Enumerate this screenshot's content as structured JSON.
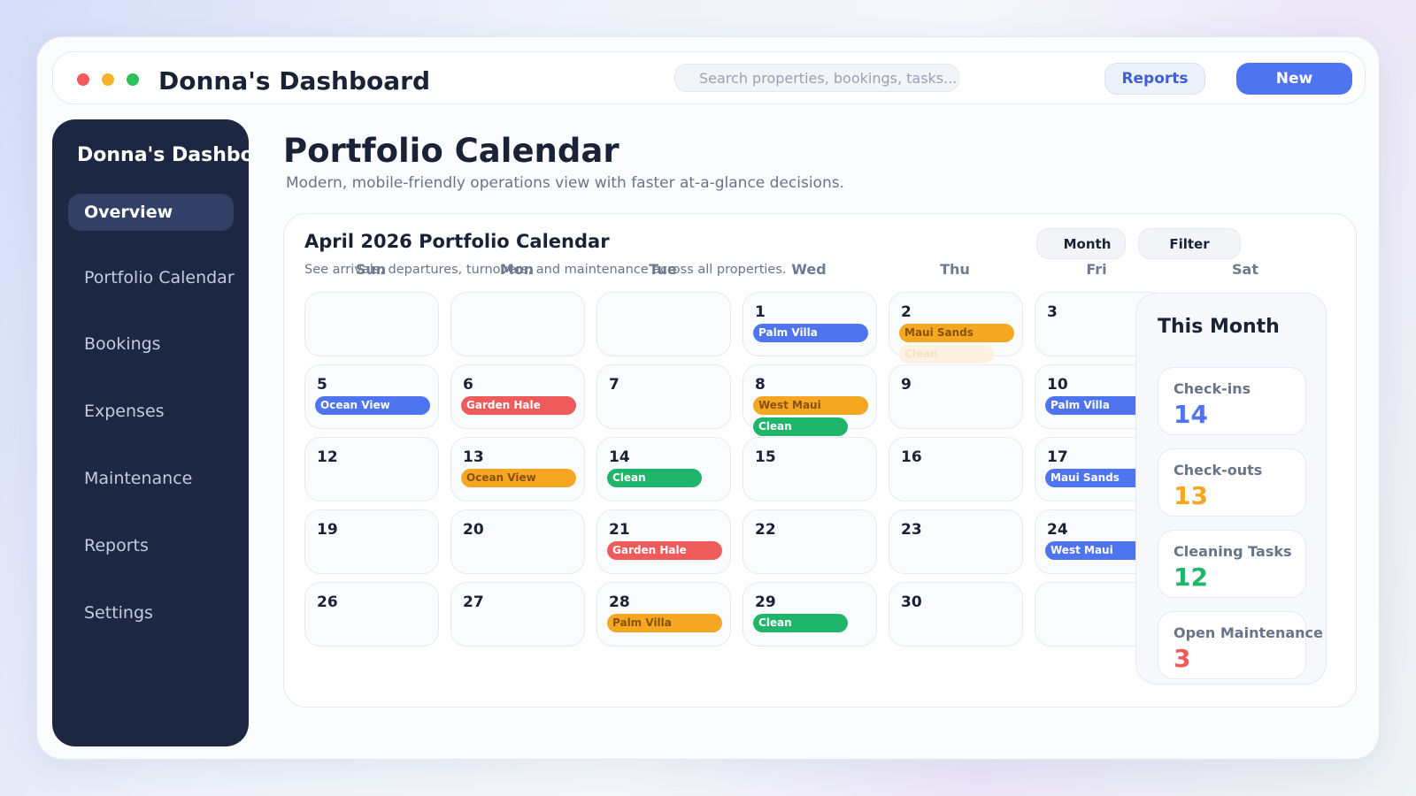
{
  "app": {
    "title": "Donna's Dashboard",
    "window_controls": [
      "close",
      "minimize",
      "maximize"
    ]
  },
  "search": {
    "placeholder": "Search properties, bookings, tasks..."
  },
  "header": {
    "reports_label": "Reports",
    "new_label": "New"
  },
  "sidebar": {
    "title": "Donna's Dashboard",
    "items": [
      {
        "label": "Overview",
        "active": true
      },
      {
        "label": "Portfolio Calendar",
        "active": false
      },
      {
        "label": "Bookings",
        "active": false
      },
      {
        "label": "Expenses",
        "active": false
      },
      {
        "label": "Maintenance",
        "active": false
      },
      {
        "label": "Reports",
        "active": false
      },
      {
        "label": "Settings",
        "active": false
      }
    ]
  },
  "page": {
    "title": "Portfolio Calendar",
    "subtitle": "Modern, mobile-friendly operations view with faster at-a-glance decisions."
  },
  "calendar": {
    "title": "April 2026 Portfolio Calendar",
    "subtitle": "See arrivals, departures, turnovers, and maintenance across all properties.",
    "month_button": "Month",
    "filter_button": "Filter",
    "weekdays": [
      "Sun",
      "Mon",
      "Tue",
      "Wed",
      "Thu",
      "Fri",
      "Sat"
    ],
    "days": [
      {
        "num": "",
        "events": []
      },
      {
        "num": "",
        "events": []
      },
      {
        "num": "",
        "events": []
      },
      {
        "num": "1",
        "events": [
          {
            "label": "Palm Villa",
            "color": "blue"
          }
        ]
      },
      {
        "num": "2",
        "events": [
          {
            "label": "Maui Sands",
            "color": "orange"
          },
          {
            "label": "Clean",
            "color": "faded"
          }
        ]
      },
      {
        "num": "3",
        "events": []
      },
      {
        "num": "5",
        "events": [
          {
            "label": "Ocean View",
            "color": "blue"
          }
        ]
      },
      {
        "num": "6",
        "events": [
          {
            "label": "Garden Hale",
            "color": "red"
          }
        ]
      },
      {
        "num": "7",
        "events": []
      },
      {
        "num": "8",
        "events": [
          {
            "label": "West Maui",
            "color": "orange"
          },
          {
            "label": "Clean",
            "color": "green"
          }
        ]
      },
      {
        "num": "9",
        "events": []
      },
      {
        "num": "10",
        "events": [
          {
            "label": "Palm Villa",
            "color": "blue"
          }
        ]
      },
      {
        "num": "12",
        "events": []
      },
      {
        "num": "13",
        "events": [
          {
            "label": "Ocean View",
            "color": "orange"
          }
        ]
      },
      {
        "num": "14",
        "events": [
          {
            "label": "Clean",
            "color": "green"
          }
        ]
      },
      {
        "num": "15",
        "events": []
      },
      {
        "num": "16",
        "events": []
      },
      {
        "num": "17",
        "events": [
          {
            "label": "Maui Sands",
            "color": "blue"
          }
        ]
      },
      {
        "num": "19",
        "events": []
      },
      {
        "num": "20",
        "events": []
      },
      {
        "num": "21",
        "events": [
          {
            "label": "Garden Hale",
            "color": "red"
          }
        ]
      },
      {
        "num": "22",
        "events": []
      },
      {
        "num": "23",
        "events": []
      },
      {
        "num": "24",
        "events": [
          {
            "label": "West Maui",
            "color": "blue"
          }
        ]
      },
      {
        "num": "26",
        "events": []
      },
      {
        "num": "27",
        "events": []
      },
      {
        "num": "28",
        "events": [
          {
            "label": "Palm Villa",
            "color": "orange"
          }
        ]
      },
      {
        "num": "29",
        "events": [
          {
            "label": "Clean",
            "color": "green"
          }
        ]
      },
      {
        "num": "30",
        "events": []
      },
      {
        "num": "",
        "events": []
      }
    ]
  },
  "summary": {
    "title": "This Month",
    "stats": [
      {
        "label": "Check-ins",
        "value": "14",
        "color": "#4f74ef"
      },
      {
        "label": "Check-outs",
        "value": "13",
        "color": "#f5a623"
      },
      {
        "label": "Cleaning Tasks",
        "value": "12",
        "color": "#1fb56a"
      },
      {
        "label": "Open Maintenance",
        "value": "3",
        "color": "#ef5b5b"
      }
    ]
  }
}
